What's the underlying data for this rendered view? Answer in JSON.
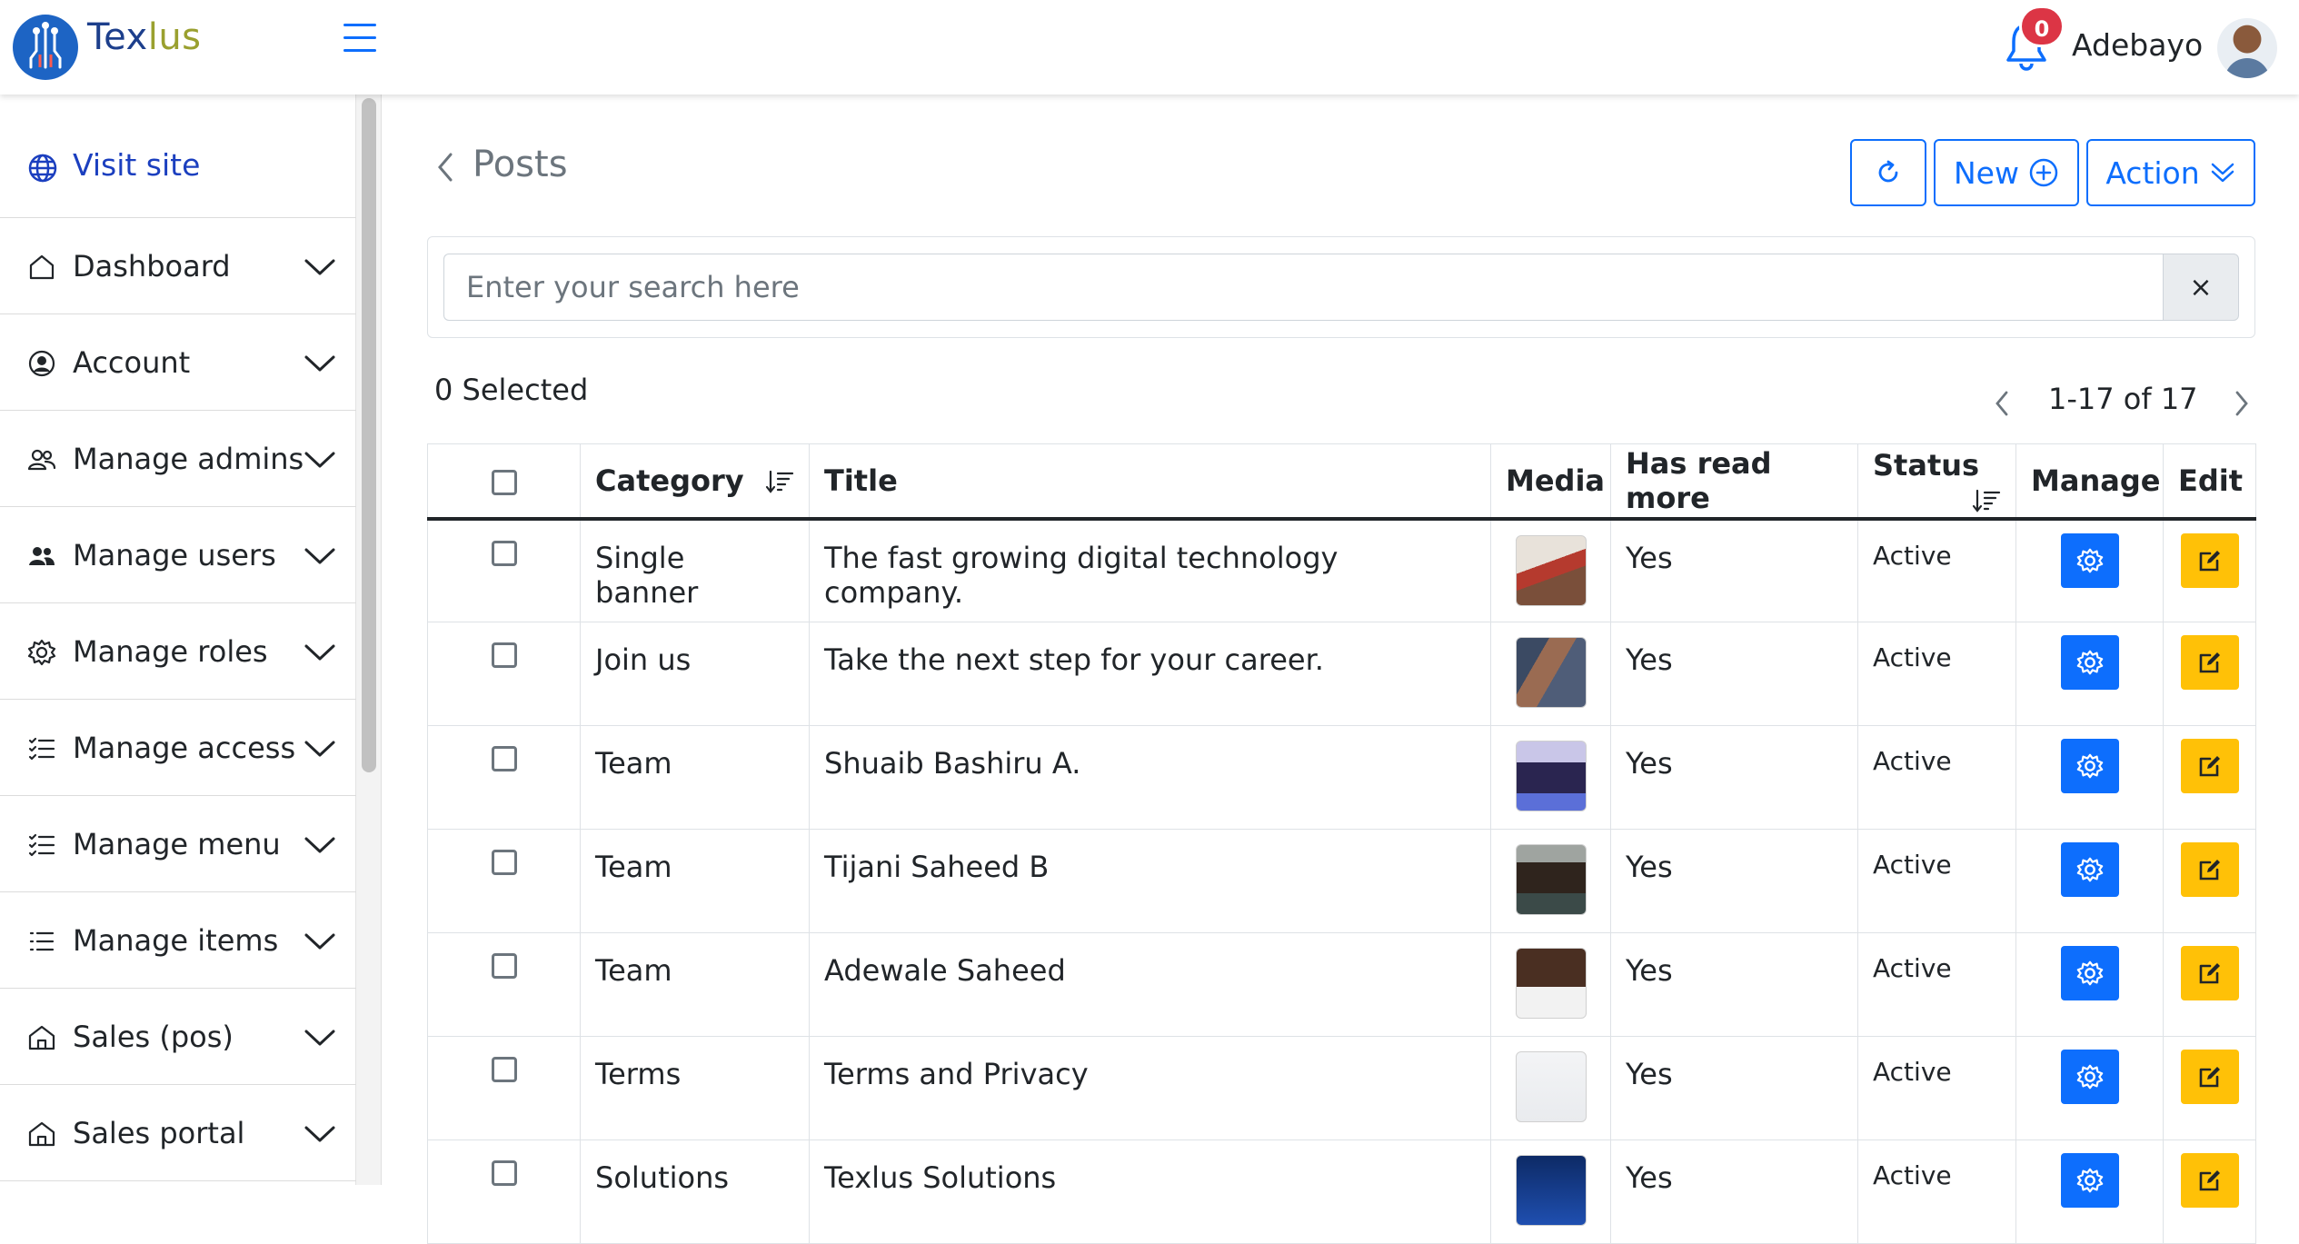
{
  "header": {
    "brand_part1": "Tex",
    "brand_part2": "lus",
    "notification_count": "0",
    "user_name": "Adebayo"
  },
  "sidebar": {
    "visit_site": "Visit site",
    "items": [
      {
        "label": "Dashboard",
        "icon": "home-icon"
      },
      {
        "label": "Account",
        "icon": "user-circle-icon"
      },
      {
        "label": "Manage admins",
        "icon": "people-outline-icon"
      },
      {
        "label": "Manage users",
        "icon": "people-filled-icon"
      },
      {
        "label": "Manage roles",
        "icon": "gear-icon"
      },
      {
        "label": "Manage access",
        "icon": "checklist-icon"
      },
      {
        "label": "Manage menu",
        "icon": "checklist-icon"
      },
      {
        "label": "Manage items",
        "icon": "list-icon"
      },
      {
        "label": "Sales (pos)",
        "icon": "shop-icon"
      },
      {
        "label": "Sales portal",
        "icon": "shop-icon"
      }
    ]
  },
  "page": {
    "title": "Posts",
    "new_label": "New",
    "action_label": "Action"
  },
  "search": {
    "placeholder": "Enter your search here",
    "clear": "×"
  },
  "selection": {
    "text": "0 Selected"
  },
  "pagination": {
    "text": "1-17 of 17"
  },
  "table": {
    "headers": {
      "category": "Category",
      "title": "Title",
      "media": "Media",
      "read_more": "Has read more",
      "status": "Status",
      "manage": "Manage",
      "edit": "Edit"
    },
    "rows": [
      {
        "category": "Single banner",
        "title": "The fast growing digital technology company.",
        "read_more": "Yes",
        "status": "Active"
      },
      {
        "category": "Join us",
        "title": "Take the next step for your career.",
        "read_more": "Yes",
        "status": "Active"
      },
      {
        "category": "Team",
        "title": "Shuaib Bashiru A.",
        "read_more": "Yes",
        "status": "Active"
      },
      {
        "category": "Team",
        "title": "Tijani Saheed B",
        "read_more": "Yes",
        "status": "Active"
      },
      {
        "category": "Team",
        "title": "Adewale Saheed",
        "read_more": "Yes",
        "status": "Active"
      },
      {
        "category": "Terms",
        "title": "Terms and Privacy",
        "read_more": "Yes",
        "status": "Active"
      },
      {
        "category": "Solutions",
        "title": "Texlus Solutions",
        "read_more": "Yes",
        "status": "Active"
      }
    ]
  },
  "colors": {
    "primary": "#0d6efd",
    "warning": "#ffc107",
    "danger": "#dc3545"
  }
}
